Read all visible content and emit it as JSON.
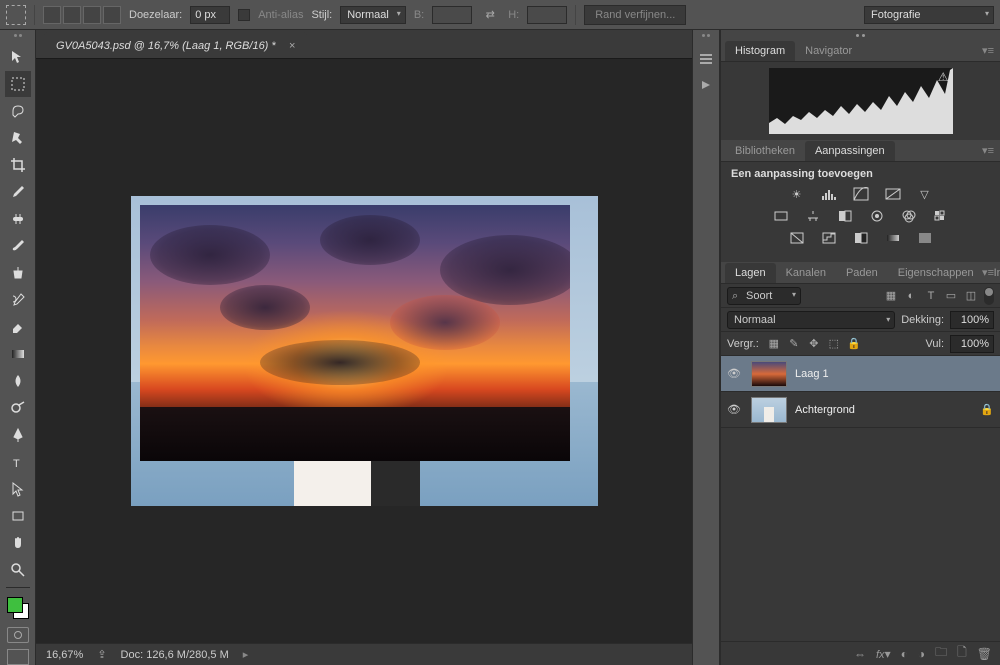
{
  "optionsBar": {
    "featherLabel": "Doezelaar:",
    "featherValue": "0 px",
    "antiAliasLabel": "Anti-alias",
    "styleLabel": "Stijl:",
    "styleValue": "Normaal",
    "widthLabel": "B:",
    "heightLabel": "H:",
    "refineEdgeLabel": "Rand verfijnen...",
    "workspaceValue": "Fotografie"
  },
  "docTab": {
    "title": "GV0A5043.psd @ 16,7% (Laag 1, RGB/16) *"
  },
  "statusBar": {
    "zoom": "16,67%",
    "docInfo": "Doc: 126,6 M/280,5 M"
  },
  "histogramPanel": {
    "tabHistogram": "Histogram",
    "tabNavigator": "Navigator"
  },
  "adjustmentsPanel": {
    "tabLibraries": "Bibliotheken",
    "tabAdjustments": "Aanpassingen",
    "addAdjustmentLabel": "Een aanpassing toevoegen"
  },
  "layersPanel": {
    "tabLayers": "Lagen",
    "tabChannels": "Kanalen",
    "tabPaths": "Paden",
    "tabProperties": "Eigenschappen",
    "tabInfo": "Info",
    "filterKindLabel": "Soort",
    "blendMode": "Normaal",
    "opacityLabel": "Dekking:",
    "opacityValue": "100%",
    "lockLabel": "Vergr.:",
    "fillLabel": "Vul:",
    "fillValue": "100%",
    "layers": [
      {
        "name": "Laag 1",
        "selected": true,
        "locked": false,
        "thumb": "sunset"
      },
      {
        "name": "Achtergrond",
        "selected": false,
        "locked": true,
        "thumb": "couple"
      }
    ]
  }
}
